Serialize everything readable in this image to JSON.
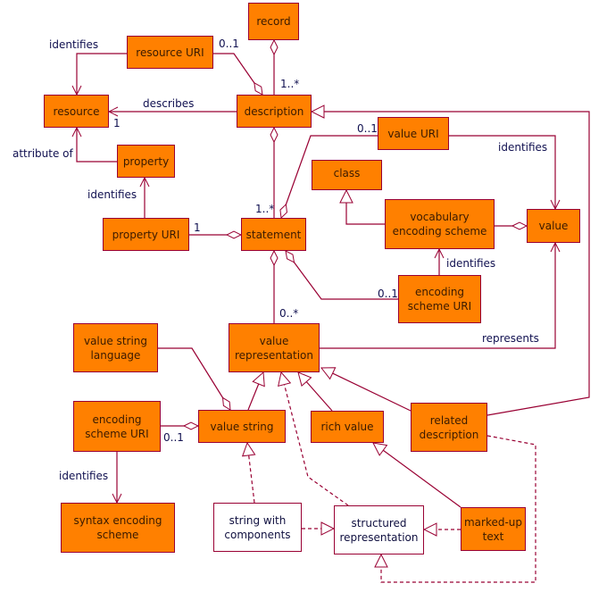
{
  "colors": {
    "class_fill": "#ff8000",
    "line": "#990033",
    "abstract_fill": "#ffffff"
  },
  "classes": {
    "record": "record",
    "resource_uri": "resource URI",
    "resource": "resource",
    "description": "description",
    "property": "property",
    "value_uri": "value URI",
    "class": "class",
    "vocabulary_encoding_scheme": "vocabulary\nencoding scheme",
    "value": "value",
    "property_uri": "property URI",
    "statement": "statement",
    "encoding_scheme_uri_upper": "encoding\nscheme URI",
    "value_representation": "value\nrepresentation",
    "value_string_language": "value string\nlanguage",
    "encoding_scheme_uri_lower": "encoding\nscheme URI",
    "value_string": "value string",
    "rich_value": "rich value",
    "related_description": "related\ndescription",
    "syntax_encoding_scheme": "syntax encoding\nscheme",
    "string_with_components": "string with\ncomponents",
    "structured_representation": "structured\nrepresentation",
    "marked_up_text": "marked-up\ntext"
  },
  "labels": {
    "identifies_resource": "identifies",
    "mult_resource_uri": "0..1",
    "mult_record": "1..*",
    "describes": "describes",
    "mult_describes": "1",
    "attribute_of": "attribute of",
    "identifies_property": "identifies",
    "mult_property_uri": "1",
    "mult_statement": "1..*",
    "mult_value_uri": "0..1",
    "identifies_value": "identifies",
    "identifies_vocab": "identifies",
    "mult_enc_uri_upper": "0..1",
    "mult_value_rep": "0..*",
    "represents": "represents",
    "mult_enc_uri_lower": "0..1",
    "identifies_syntax": "identifies"
  }
}
